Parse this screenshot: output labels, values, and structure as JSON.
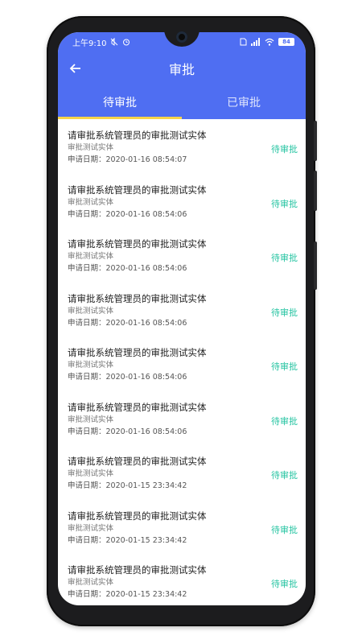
{
  "status_bar": {
    "time": "上午9:10",
    "battery": "84",
    "icons": [
      "mute-icon",
      "alarm-icon",
      "sim-icon",
      "signal-icon",
      "wifi-icon",
      "battery-icon"
    ]
  },
  "header": {
    "title": "审批",
    "back_icon": "arrow-left-icon",
    "background_color": "#4f6ef2"
  },
  "tabs": [
    {
      "label": "待审批",
      "active": true
    },
    {
      "label": "已审批",
      "active": false
    }
  ],
  "colors": {
    "accent": "#4f6ef2",
    "tab_indicator": "#f6d44a",
    "status_pending": "#26c4a2"
  },
  "items": [
    {
      "title": "请审批系统管理员的审批测试实体",
      "subtitle": "审批测试实体",
      "date": "申请日期：2020-01-16 08:54:07",
      "status": "待审批"
    },
    {
      "title": "请审批系统管理员的审批测试实体",
      "subtitle": "审批测试实体",
      "date": "申请日期：2020-01-16 08:54:06",
      "status": "待审批"
    },
    {
      "title": "请审批系统管理员的审批测试实体",
      "subtitle": "审批测试实体",
      "date": "申请日期：2020-01-16 08:54:06",
      "status": "待审批"
    },
    {
      "title": "请审批系统管理员的审批测试实体",
      "subtitle": "审批测试实体",
      "date": "申请日期：2020-01-16 08:54:06",
      "status": "待审批"
    },
    {
      "title": "请审批系统管理员的审批测试实体",
      "subtitle": "审批测试实体",
      "date": "申请日期：2020-01-16 08:54:06",
      "status": "待审批"
    },
    {
      "title": "请审批系统管理员的审批测试实体",
      "subtitle": "审批测试实体",
      "date": "申请日期：2020-01-16 08:54:06",
      "status": "待审批"
    },
    {
      "title": "请审批系统管理员的审批测试实体",
      "subtitle": "审批测试实体",
      "date": "申请日期：2020-01-15 23:34:42",
      "status": "待审批"
    },
    {
      "title": "请审批系统管理员的审批测试实体",
      "subtitle": "审批测试实体",
      "date": "申请日期：2020-01-15 23:34:42",
      "status": "待审批"
    },
    {
      "title": "请审批系统管理员的审批测试实体",
      "subtitle": "审批测试实体",
      "date": "申请日期：2020-01-15 23:34:42",
      "status": "待审批"
    }
  ]
}
